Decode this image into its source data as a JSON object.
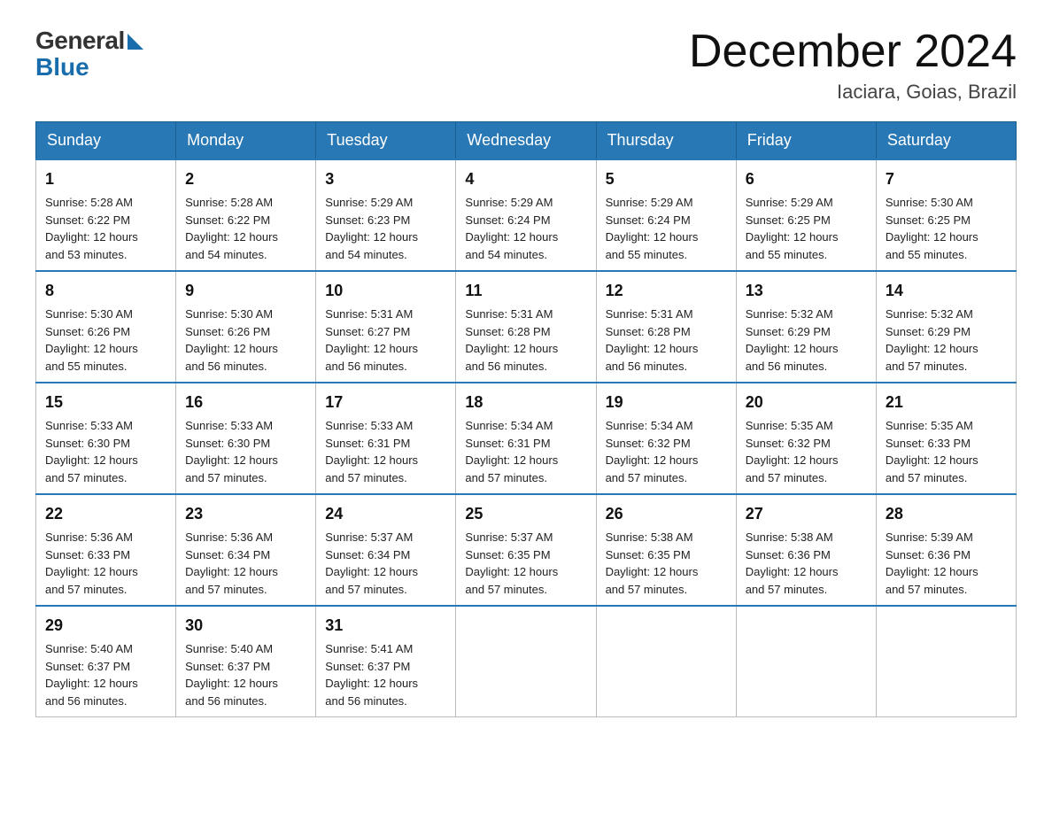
{
  "header": {
    "logo_general": "General",
    "logo_blue": "Blue",
    "month_year": "December 2024",
    "location": "Iaciara, Goias, Brazil"
  },
  "weekdays": [
    "Sunday",
    "Monday",
    "Tuesday",
    "Wednesday",
    "Thursday",
    "Friday",
    "Saturday"
  ],
  "weeks": [
    [
      {
        "day": "1",
        "sunrise": "5:28 AM",
        "sunset": "6:22 PM",
        "daylight": "12 hours and 53 minutes."
      },
      {
        "day": "2",
        "sunrise": "5:28 AM",
        "sunset": "6:22 PM",
        "daylight": "12 hours and 54 minutes."
      },
      {
        "day": "3",
        "sunrise": "5:29 AM",
        "sunset": "6:23 PM",
        "daylight": "12 hours and 54 minutes."
      },
      {
        "day": "4",
        "sunrise": "5:29 AM",
        "sunset": "6:24 PM",
        "daylight": "12 hours and 54 minutes."
      },
      {
        "day": "5",
        "sunrise": "5:29 AM",
        "sunset": "6:24 PM",
        "daylight": "12 hours and 55 minutes."
      },
      {
        "day": "6",
        "sunrise": "5:29 AM",
        "sunset": "6:25 PM",
        "daylight": "12 hours and 55 minutes."
      },
      {
        "day": "7",
        "sunrise": "5:30 AM",
        "sunset": "6:25 PM",
        "daylight": "12 hours and 55 minutes."
      }
    ],
    [
      {
        "day": "8",
        "sunrise": "5:30 AM",
        "sunset": "6:26 PM",
        "daylight": "12 hours and 55 minutes."
      },
      {
        "day": "9",
        "sunrise": "5:30 AM",
        "sunset": "6:26 PM",
        "daylight": "12 hours and 56 minutes."
      },
      {
        "day": "10",
        "sunrise": "5:31 AM",
        "sunset": "6:27 PM",
        "daylight": "12 hours and 56 minutes."
      },
      {
        "day": "11",
        "sunrise": "5:31 AM",
        "sunset": "6:28 PM",
        "daylight": "12 hours and 56 minutes."
      },
      {
        "day": "12",
        "sunrise": "5:31 AM",
        "sunset": "6:28 PM",
        "daylight": "12 hours and 56 minutes."
      },
      {
        "day": "13",
        "sunrise": "5:32 AM",
        "sunset": "6:29 PM",
        "daylight": "12 hours and 56 minutes."
      },
      {
        "day": "14",
        "sunrise": "5:32 AM",
        "sunset": "6:29 PM",
        "daylight": "12 hours and 57 minutes."
      }
    ],
    [
      {
        "day": "15",
        "sunrise": "5:33 AM",
        "sunset": "6:30 PM",
        "daylight": "12 hours and 57 minutes."
      },
      {
        "day": "16",
        "sunrise": "5:33 AM",
        "sunset": "6:30 PM",
        "daylight": "12 hours and 57 minutes."
      },
      {
        "day": "17",
        "sunrise": "5:33 AM",
        "sunset": "6:31 PM",
        "daylight": "12 hours and 57 minutes."
      },
      {
        "day": "18",
        "sunrise": "5:34 AM",
        "sunset": "6:31 PM",
        "daylight": "12 hours and 57 minutes."
      },
      {
        "day": "19",
        "sunrise": "5:34 AM",
        "sunset": "6:32 PM",
        "daylight": "12 hours and 57 minutes."
      },
      {
        "day": "20",
        "sunrise": "5:35 AM",
        "sunset": "6:32 PM",
        "daylight": "12 hours and 57 minutes."
      },
      {
        "day": "21",
        "sunrise": "5:35 AM",
        "sunset": "6:33 PM",
        "daylight": "12 hours and 57 minutes."
      }
    ],
    [
      {
        "day": "22",
        "sunrise": "5:36 AM",
        "sunset": "6:33 PM",
        "daylight": "12 hours and 57 minutes."
      },
      {
        "day": "23",
        "sunrise": "5:36 AM",
        "sunset": "6:34 PM",
        "daylight": "12 hours and 57 minutes."
      },
      {
        "day": "24",
        "sunrise": "5:37 AM",
        "sunset": "6:34 PM",
        "daylight": "12 hours and 57 minutes."
      },
      {
        "day": "25",
        "sunrise": "5:37 AM",
        "sunset": "6:35 PM",
        "daylight": "12 hours and 57 minutes."
      },
      {
        "day": "26",
        "sunrise": "5:38 AM",
        "sunset": "6:35 PM",
        "daylight": "12 hours and 57 minutes."
      },
      {
        "day": "27",
        "sunrise": "5:38 AM",
        "sunset": "6:36 PM",
        "daylight": "12 hours and 57 minutes."
      },
      {
        "day": "28",
        "sunrise": "5:39 AM",
        "sunset": "6:36 PM",
        "daylight": "12 hours and 57 minutes."
      }
    ],
    [
      {
        "day": "29",
        "sunrise": "5:40 AM",
        "sunset": "6:37 PM",
        "daylight": "12 hours and 56 minutes."
      },
      {
        "day": "30",
        "sunrise": "5:40 AM",
        "sunset": "6:37 PM",
        "daylight": "12 hours and 56 minutes."
      },
      {
        "day": "31",
        "sunrise": "5:41 AM",
        "sunset": "6:37 PM",
        "daylight": "12 hours and 56 minutes."
      },
      null,
      null,
      null,
      null
    ]
  ],
  "labels": {
    "sunrise": "Sunrise: ",
    "sunset": "Sunset: ",
    "daylight": "Daylight: "
  }
}
